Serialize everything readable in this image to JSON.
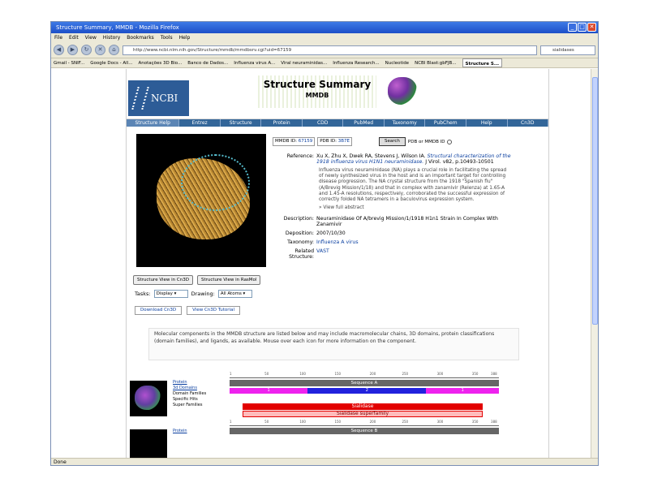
{
  "browser": {
    "title": "Structure Summary, MMDB - Mozilla Firefox",
    "menu": [
      "File",
      "Edit",
      "View",
      "History",
      "Bookmarks",
      "Tools",
      "Help"
    ],
    "url": "http://www.ncbi.nlm.nih.gov/Structure/mmdb/mmdbsrv.cgi?uid=67159",
    "search_text": "sialidases",
    "bookmarks": [
      "Gmail - SNIF...",
      "Google Docs - All...",
      "Anotações 3D Bio...",
      "Banco de Dados...",
      "Influenza virus A...",
      "Viral neuraminidas...",
      "Influenza Research...",
      "Nucleotide",
      "NCBI Blast:gbFJB...",
      "Structure S..."
    ],
    "status": "Done"
  },
  "header": {
    "logo": "NCBI",
    "title": "Structure Summary",
    "subtitle": "MMDB"
  },
  "tabs": [
    "Structure Help",
    "Entrez",
    "Structure",
    "Protein",
    "CDD",
    "PubMed",
    "Taxonomy",
    "PubChem",
    "Help",
    "Cn3D"
  ],
  "search": {
    "mmdb_label": "MMDB ID:",
    "mmdb_id": "67159",
    "pdb_label": "PDB ID:",
    "pdb_id": "3B7E",
    "button": "Search",
    "option": "PDB or MMDB ID"
  },
  "info": {
    "reference_label": "Reference:",
    "reference_text": "Xu X, Zhu X, Dwek RA, Stevens J, Wilson IA.",
    "reference_title": "Structural characterization of the 1918 influenza virus H1N1 neuraminidase.",
    "reference_journal": "J Virol. v82, p.10493-10501",
    "abstract": "Influenza virus neuraminidase (NA) plays a crucial role in facilitating the spread of newly synthesized virus in the host and is an important target for controlling disease progression. The NA crystal structure from the 1918 \"Spanish flu\" (A/Brevig Mission/1/18) and that in complex with zanamivir (Relenza) at 1.65-A and 1.45-A resolutions, respectively, corroborated the successful expression of correctly folded NA tetramers in a baculovirus expression system.",
    "view_abstract": "View full abstract",
    "description_label": "Description:",
    "description": "Neuraminidase Of A/brevig Mission/1/1918 H1n1 Strain In Complex With Zanamivir",
    "deposition_label": "Deposition:",
    "deposition": "2007/10/30",
    "taxonomy_label": "Taxonomy:",
    "taxonomy": "Influenza A virus",
    "related_label": "Related Structure:",
    "related": "VAST"
  },
  "viewer": {
    "btn_cn3d": "Structure View in Cn3D",
    "btn_rasmol": "Structure View in RasMol",
    "tasks_label": "Tasks:",
    "tasks_value": "Display",
    "drawing_label": "Drawing:",
    "drawing_value": "All Atoms",
    "download_btn": "Download Cn3D",
    "tutorial_btn": "View Cn3D Tutorial"
  },
  "note": "Molecular components in the MMDB structure are listed below and may include macromolecular chains, 3D domains, protein classifications (domain families), and ligands, as available. Mouse over each icon for more information on the component.",
  "graphics": {
    "row_labels": [
      "Protein",
      "3d Domains",
      "Domain Families",
      "Specific Hits",
      "Super Families"
    ],
    "ticks1": [
      "1",
      "50",
      "100",
      "150",
      "200",
      "250",
      "300",
      "350",
      "388"
    ],
    "sequence_a": "Sequence A",
    "domains": [
      "1",
      "2",
      "1"
    ],
    "specific_hit": "Sialidase",
    "superfamily": "Sialidase superfamily",
    "protein2": "Protein",
    "ticks2": [
      "1",
      "50",
      "100",
      "150",
      "200",
      "250",
      "300",
      "350",
      "388"
    ],
    "sequence_b": "Sequence B"
  }
}
